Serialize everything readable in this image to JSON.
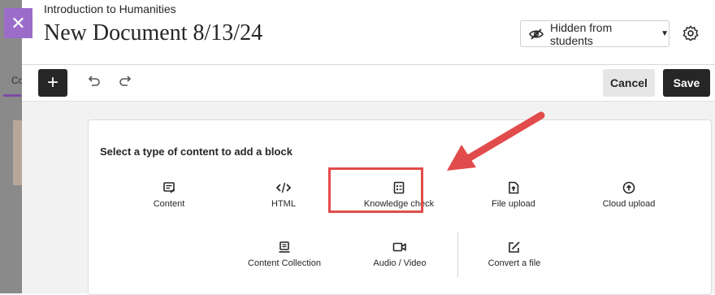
{
  "background": {
    "tab_label": "Co"
  },
  "header": {
    "course_name": "Introduction to Humanities",
    "document_title": "New Document 8/13/24",
    "visibility_label": "Hidden from students"
  },
  "toolbar": {
    "cancel_label": "Cancel",
    "save_label": "Save"
  },
  "block_picker": {
    "prompt": "Select a type of content to add a block",
    "row1": [
      {
        "label": "Content",
        "icon": "edit-icon"
      },
      {
        "label": "HTML",
        "icon": "code-icon"
      },
      {
        "label": "Knowledge check",
        "icon": "checklist-icon"
      },
      {
        "label": "File upload",
        "icon": "file-upload-icon"
      },
      {
        "label": "Cloud upload",
        "icon": "cloud-upload-icon"
      }
    ],
    "row2": [
      {
        "label": "Content Collection",
        "icon": "collection-icon"
      },
      {
        "label": "Audio / Video",
        "icon": "video-icon"
      },
      {
        "label": "Convert a file",
        "icon": "convert-icon"
      }
    ]
  },
  "colors": {
    "accent_purple": "#9b6cc8",
    "annotation_red": "#e24b4b",
    "dark_button": "#262626"
  }
}
